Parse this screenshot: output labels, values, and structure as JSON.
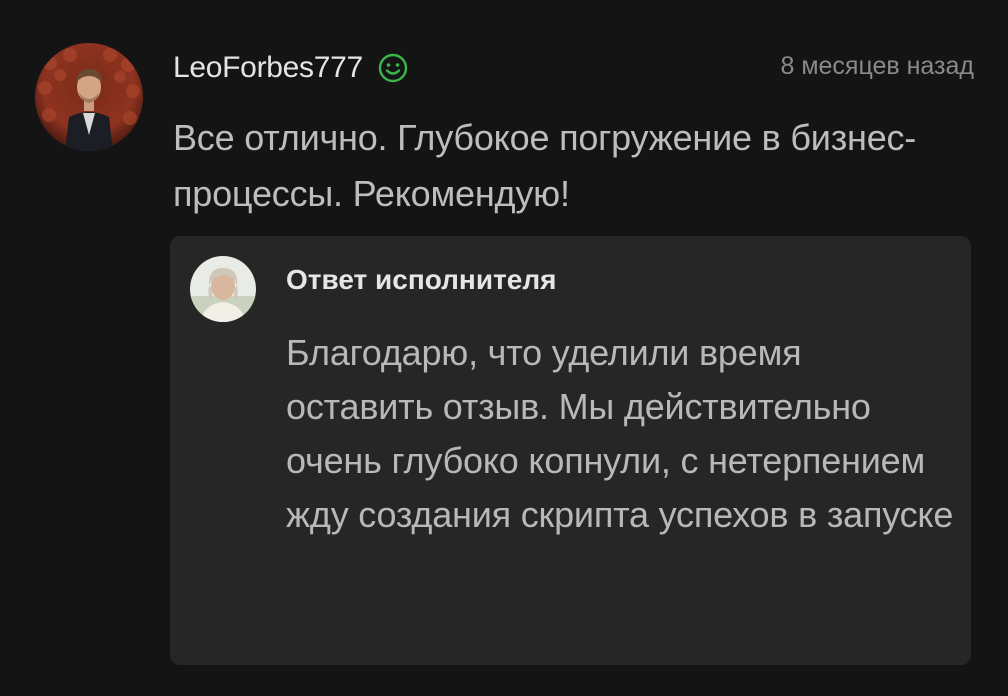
{
  "review": {
    "author": "LeoForbes777",
    "author_badge_icon": "smile-icon",
    "timestamp": "8 месяцев назад",
    "text": "Все отлично. Глубокое погружение в бизнес-процессы. Рекомендую!",
    "avatar_icon": "user-avatar"
  },
  "reply": {
    "title": "Ответ исполнителя",
    "text": "Благодарю, что уделили время оставить отзыв. Мы действительно очень глубоко копнули, с нетерпением жду создания скрипта успехов в запуске",
    "avatar_icon": "performer-avatar"
  },
  "colors": {
    "background": "#141414",
    "card": "#262626",
    "badge_green": "#3bb54a",
    "muted_text": "#8a8a8a"
  }
}
